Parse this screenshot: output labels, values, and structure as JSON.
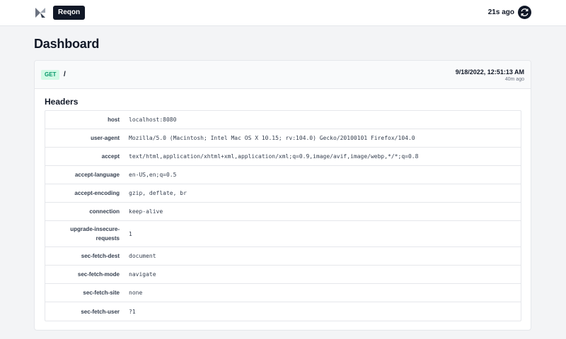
{
  "app": {
    "brand": "Reqon",
    "last_updated": "21s ago"
  },
  "page": {
    "title": "Dashboard"
  },
  "request": {
    "method": "GET",
    "path": "/",
    "timestamp": "9/18/2022, 12:51:13 AM",
    "age": "40m ago",
    "headers_title": "Headers",
    "headers": [
      {
        "key": "host",
        "value": "localhost:8080"
      },
      {
        "key": "user-agent",
        "value": "Mozilla/5.0 (Macintosh; Intel Mac OS X 10.15; rv:104.0) Gecko/20100101 Firefox/104.0"
      },
      {
        "key": "accept",
        "value": "text/html,application/xhtml+xml,application/xml;q=0.9,image/avif,image/webp,*/*;q=0.8"
      },
      {
        "key": "accept-language",
        "value": "en-US,en;q=0.5"
      },
      {
        "key": "accept-encoding",
        "value": "gzip, deflate, br"
      },
      {
        "key": "connection",
        "value": "keep-alive"
      },
      {
        "key": "upgrade-insecure-requests",
        "value": "1"
      },
      {
        "key": "sec-fetch-dest",
        "value": "document"
      },
      {
        "key": "sec-fetch-mode",
        "value": "navigate"
      },
      {
        "key": "sec-fetch-site",
        "value": "none"
      },
      {
        "key": "sec-fetch-user",
        "value": "?1"
      }
    ]
  },
  "icons": {
    "logo": "reqon-logo-icon",
    "refresh": "refresh-icon"
  },
  "colors": {
    "dark": "#111827",
    "method_bg": "#d1fae5",
    "method_fg": "#059669",
    "page_bg": "#f3f4f6"
  }
}
